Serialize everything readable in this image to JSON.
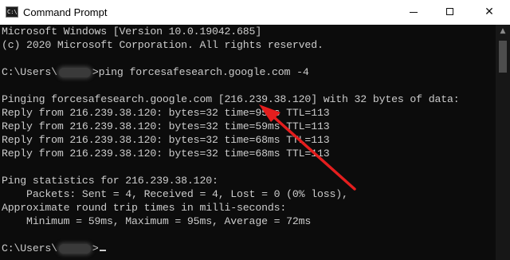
{
  "window": {
    "title": "Command Prompt",
    "icon_name": "cmd-icon",
    "icon_text": "C:\\",
    "controls": {
      "minimize": "minimize-icon",
      "maximize": "maximize-icon",
      "close": "close-icon",
      "close_glyph": "✕"
    }
  },
  "console": {
    "lines": [
      "Microsoft Windows [Version 10.0.19042.685]",
      "(c) 2020 Microsoft Corporation. All rights reserved.",
      "",
      "",
      "",
      "Pinging forcesafesearch.google.com [216.239.38.120] with 32 bytes of data:",
      "Reply from 216.239.38.120: bytes=32 time=95ms TTL=113",
      "Reply from 216.239.38.120: bytes=32 time=59ms TTL=113",
      "Reply from 216.239.38.120: bytes=32 time=68ms TTL=113",
      "Reply from 216.239.38.120: bytes=32 time=68ms TTL=113",
      "",
      "Ping statistics for 216.239.38.120:",
      "    Packets: Sent = 4, Received = 4, Lost = 0 (0% loss),",
      "Approximate round trip times in milli-seconds:",
      "    Minimum = 59ms, Maximum = 95ms, Average = 72ms",
      ""
    ],
    "prompt1_prefix": "C:\\Users\\",
    "prompt1_suffix": ">ping forcesafesearch.google.com -4",
    "prompt2_prefix": "C:\\Users\\",
    "prompt2_suffix": ">"
  },
  "colors": {
    "text": "#cccccc",
    "background": "#0c0c0c",
    "arrow": "#e41e1e"
  }
}
